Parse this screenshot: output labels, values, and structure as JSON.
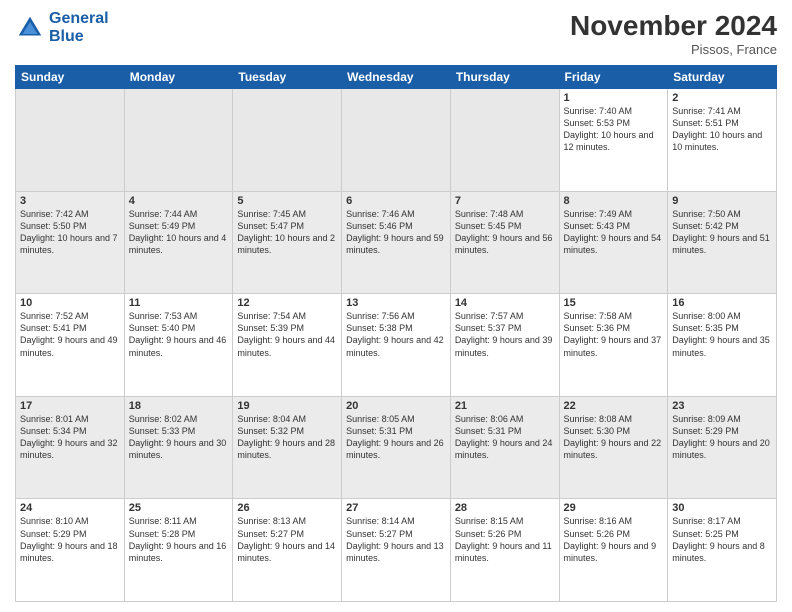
{
  "logo": {
    "line1": "General",
    "line2": "Blue"
  },
  "header": {
    "month": "November 2024",
    "location": "Pissos, France"
  },
  "days_of_week": [
    "Sunday",
    "Monday",
    "Tuesday",
    "Wednesday",
    "Thursday",
    "Friday",
    "Saturday"
  ],
  "weeks": [
    [
      {
        "day": "",
        "sunrise": "",
        "sunset": "",
        "daylight": ""
      },
      {
        "day": "",
        "sunrise": "",
        "sunset": "",
        "daylight": ""
      },
      {
        "day": "",
        "sunrise": "",
        "sunset": "",
        "daylight": ""
      },
      {
        "day": "",
        "sunrise": "",
        "sunset": "",
        "daylight": ""
      },
      {
        "day": "",
        "sunrise": "",
        "sunset": "",
        "daylight": ""
      },
      {
        "day": "1",
        "sunrise": "Sunrise: 7:40 AM",
        "sunset": "Sunset: 5:53 PM",
        "daylight": "Daylight: 10 hours and 12 minutes."
      },
      {
        "day": "2",
        "sunrise": "Sunrise: 7:41 AM",
        "sunset": "Sunset: 5:51 PM",
        "daylight": "Daylight: 10 hours and 10 minutes."
      }
    ],
    [
      {
        "day": "3",
        "sunrise": "Sunrise: 7:42 AM",
        "sunset": "Sunset: 5:50 PM",
        "daylight": "Daylight: 10 hours and 7 minutes."
      },
      {
        "day": "4",
        "sunrise": "Sunrise: 7:44 AM",
        "sunset": "Sunset: 5:49 PM",
        "daylight": "Daylight: 10 hours and 4 minutes."
      },
      {
        "day": "5",
        "sunrise": "Sunrise: 7:45 AM",
        "sunset": "Sunset: 5:47 PM",
        "daylight": "Daylight: 10 hours and 2 minutes."
      },
      {
        "day": "6",
        "sunrise": "Sunrise: 7:46 AM",
        "sunset": "Sunset: 5:46 PM",
        "daylight": "Daylight: 9 hours and 59 minutes."
      },
      {
        "day": "7",
        "sunrise": "Sunrise: 7:48 AM",
        "sunset": "Sunset: 5:45 PM",
        "daylight": "Daylight: 9 hours and 56 minutes."
      },
      {
        "day": "8",
        "sunrise": "Sunrise: 7:49 AM",
        "sunset": "Sunset: 5:43 PM",
        "daylight": "Daylight: 9 hours and 54 minutes."
      },
      {
        "day": "9",
        "sunrise": "Sunrise: 7:50 AM",
        "sunset": "Sunset: 5:42 PM",
        "daylight": "Daylight: 9 hours and 51 minutes."
      }
    ],
    [
      {
        "day": "10",
        "sunrise": "Sunrise: 7:52 AM",
        "sunset": "Sunset: 5:41 PM",
        "daylight": "Daylight: 9 hours and 49 minutes."
      },
      {
        "day": "11",
        "sunrise": "Sunrise: 7:53 AM",
        "sunset": "Sunset: 5:40 PM",
        "daylight": "Daylight: 9 hours and 46 minutes."
      },
      {
        "day": "12",
        "sunrise": "Sunrise: 7:54 AM",
        "sunset": "Sunset: 5:39 PM",
        "daylight": "Daylight: 9 hours and 44 minutes."
      },
      {
        "day": "13",
        "sunrise": "Sunrise: 7:56 AM",
        "sunset": "Sunset: 5:38 PM",
        "daylight": "Daylight: 9 hours and 42 minutes."
      },
      {
        "day": "14",
        "sunrise": "Sunrise: 7:57 AM",
        "sunset": "Sunset: 5:37 PM",
        "daylight": "Daylight: 9 hours and 39 minutes."
      },
      {
        "day": "15",
        "sunrise": "Sunrise: 7:58 AM",
        "sunset": "Sunset: 5:36 PM",
        "daylight": "Daylight: 9 hours and 37 minutes."
      },
      {
        "day": "16",
        "sunrise": "Sunrise: 8:00 AM",
        "sunset": "Sunset: 5:35 PM",
        "daylight": "Daylight: 9 hours and 35 minutes."
      }
    ],
    [
      {
        "day": "17",
        "sunrise": "Sunrise: 8:01 AM",
        "sunset": "Sunset: 5:34 PM",
        "daylight": "Daylight: 9 hours and 32 minutes."
      },
      {
        "day": "18",
        "sunrise": "Sunrise: 8:02 AM",
        "sunset": "Sunset: 5:33 PM",
        "daylight": "Daylight: 9 hours and 30 minutes."
      },
      {
        "day": "19",
        "sunrise": "Sunrise: 8:04 AM",
        "sunset": "Sunset: 5:32 PM",
        "daylight": "Daylight: 9 hours and 28 minutes."
      },
      {
        "day": "20",
        "sunrise": "Sunrise: 8:05 AM",
        "sunset": "Sunset: 5:31 PM",
        "daylight": "Daylight: 9 hours and 26 minutes."
      },
      {
        "day": "21",
        "sunrise": "Sunrise: 8:06 AM",
        "sunset": "Sunset: 5:31 PM",
        "daylight": "Daylight: 9 hours and 24 minutes."
      },
      {
        "day": "22",
        "sunrise": "Sunrise: 8:08 AM",
        "sunset": "Sunset: 5:30 PM",
        "daylight": "Daylight: 9 hours and 22 minutes."
      },
      {
        "day": "23",
        "sunrise": "Sunrise: 8:09 AM",
        "sunset": "Sunset: 5:29 PM",
        "daylight": "Daylight: 9 hours and 20 minutes."
      }
    ],
    [
      {
        "day": "24",
        "sunrise": "Sunrise: 8:10 AM",
        "sunset": "Sunset: 5:29 PM",
        "daylight": "Daylight: 9 hours and 18 minutes."
      },
      {
        "day": "25",
        "sunrise": "Sunrise: 8:11 AM",
        "sunset": "Sunset: 5:28 PM",
        "daylight": "Daylight: 9 hours and 16 minutes."
      },
      {
        "day": "26",
        "sunrise": "Sunrise: 8:13 AM",
        "sunset": "Sunset: 5:27 PM",
        "daylight": "Daylight: 9 hours and 14 minutes."
      },
      {
        "day": "27",
        "sunrise": "Sunrise: 8:14 AM",
        "sunset": "Sunset: 5:27 PM",
        "daylight": "Daylight: 9 hours and 13 minutes."
      },
      {
        "day": "28",
        "sunrise": "Sunrise: 8:15 AM",
        "sunset": "Sunset: 5:26 PM",
        "daylight": "Daylight: 9 hours and 11 minutes."
      },
      {
        "day": "29",
        "sunrise": "Sunrise: 8:16 AM",
        "sunset": "Sunset: 5:26 PM",
        "daylight": "Daylight: 9 hours and 9 minutes."
      },
      {
        "day": "30",
        "sunrise": "Sunrise: 8:17 AM",
        "sunset": "Sunset: 5:25 PM",
        "daylight": "Daylight: 9 hours and 8 minutes."
      }
    ]
  ]
}
